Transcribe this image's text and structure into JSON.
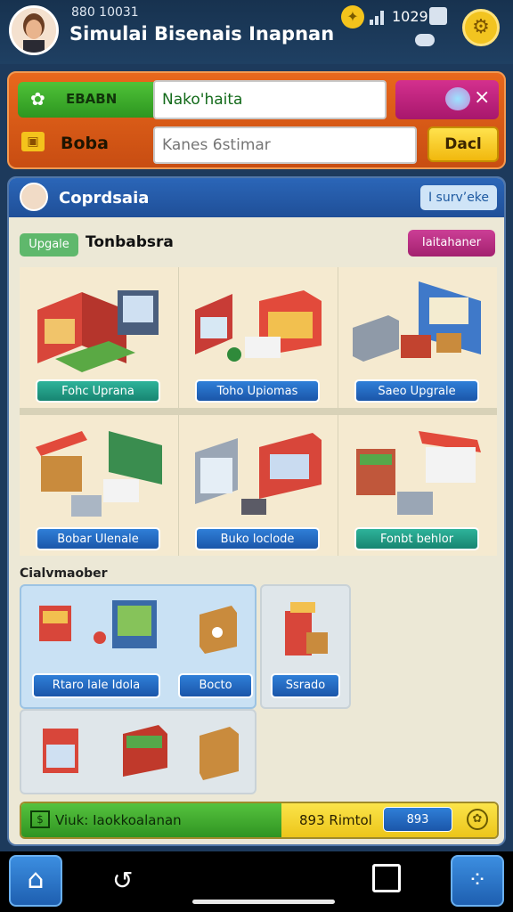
{
  "status": {
    "code": "880 10031",
    "coins": "1029"
  },
  "app": {
    "title": "Simulai Bisenais Inapnan"
  },
  "topPanel": {
    "badge_label": "EBABN",
    "input1_value": "Nako'haita",
    "row2_label": "Boba",
    "input2_placeholder": "Kanes 6stimar",
    "yellow_button": "Dacl",
    "close_glyph": "×"
  },
  "main": {
    "header_title": "Coprdsaia",
    "header_button": "I surv’eke",
    "upgrade_pill": "Upgale",
    "section_title": "Tonbabsra",
    "pink_button": "Iaitahaner",
    "cells": [
      {
        "button": "Fohc Uprana",
        "style": "teal"
      },
      {
        "button": "Toho Upiomas",
        "style": "blue"
      },
      {
        "button": "Saeo Upgrale",
        "style": "blue"
      },
      {
        "button": "Bobar Ulenale",
        "style": "blue"
      },
      {
        "button": "Buko loclode",
        "style": "blue"
      },
      {
        "button": "Fonbt behlor",
        "style": "teal"
      }
    ],
    "subsection_title": "Cialvmaober",
    "sub_buttons": [
      "Rtaro Iale Idola",
      "Bocto",
      "Ssrado"
    ],
    "footer_green": "Viuk: Iaokkoalanan",
    "footer_yellow": "893 Rimtol",
    "footer_pill": "893"
  },
  "icons": {
    "top_bulb": "lightbulb-icon",
    "settings": "settings-gear-icon",
    "home": "home-icon",
    "back": "back-icon",
    "copy": "copy-icon",
    "menu": "apps-menu-icon"
  }
}
